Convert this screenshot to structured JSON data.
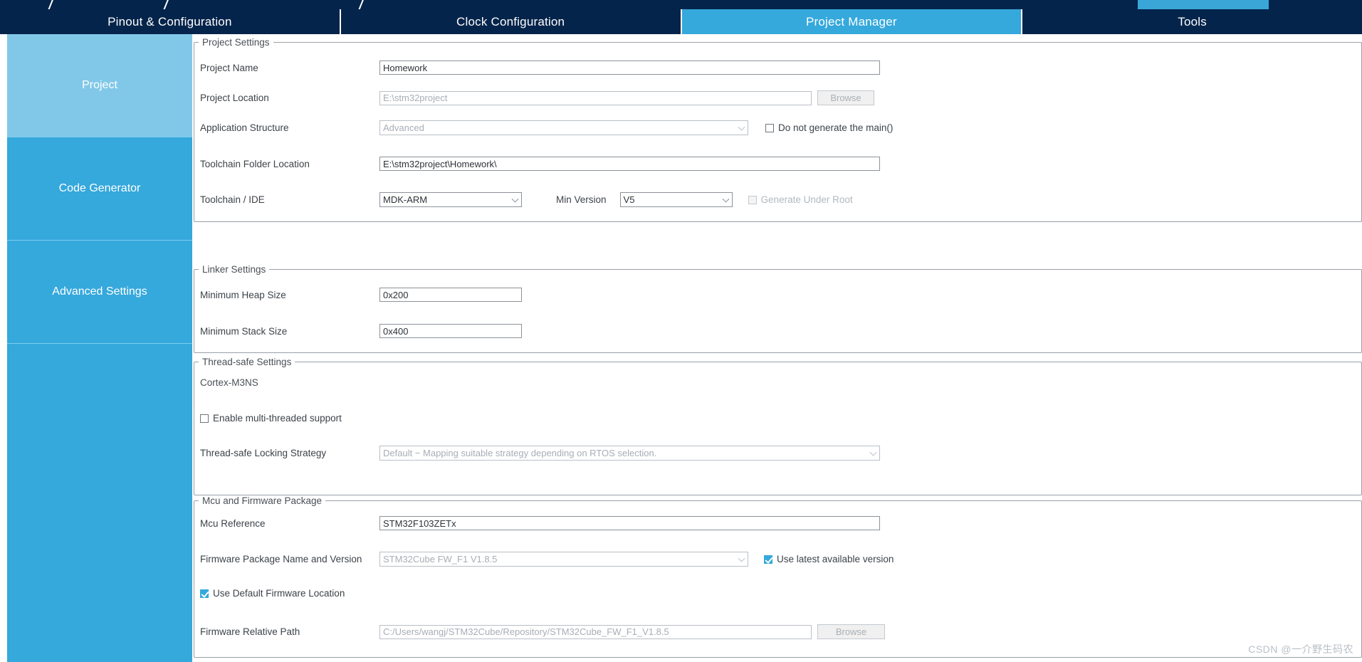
{
  "window": {
    "tabs": [
      {
        "label": "Pinout & Configuration",
        "active": false
      },
      {
        "label": "Clock Configuration",
        "active": false
      },
      {
        "label": "Project Manager",
        "active": true
      },
      {
        "label": "Tools",
        "active": false
      }
    ]
  },
  "sidebar": {
    "items": [
      {
        "label": "Project",
        "active": true
      },
      {
        "label": "Code Generator",
        "active": false
      },
      {
        "label": "Advanced Settings",
        "active": false
      }
    ]
  },
  "project_settings": {
    "legend": "Project Settings",
    "project_name": {
      "label": "Project Name",
      "value": "Homework"
    },
    "project_location": {
      "label": "Project Location",
      "value": "E:\\stm32project",
      "browse_label": "Browse"
    },
    "application_structure": {
      "label": "Application Structure",
      "value": "Advanced",
      "checkbox_label": "Do not generate the main()",
      "checkbox_checked": false
    },
    "toolchain_folder_location": {
      "label": "Toolchain Folder Location",
      "value": "E:\\stm32project\\Homework\\"
    },
    "toolchain_ide": {
      "label": "Toolchain / IDE",
      "value": "MDK-ARM",
      "min_version_label": "Min Version",
      "min_version_value": "V5",
      "generate_under_root_label": "Generate Under Root",
      "generate_under_root_checked": false
    }
  },
  "linker_settings": {
    "legend": "Linker Settings",
    "minimum_heap_size": {
      "label": "Minimum Heap Size",
      "value": "0x200"
    },
    "minimum_stack_size": {
      "label": "Minimum Stack Size",
      "value": "0x400"
    }
  },
  "thread_safe_settings": {
    "legend": "Thread-safe Settings",
    "core_name": "Cortex-M3NS",
    "enable_multithreaded": {
      "label": "Enable multi-threaded support",
      "checked": false
    },
    "locking_strategy": {
      "label": "Thread-safe Locking Strategy",
      "value": "Default  −  Mapping suitable strategy depending on RTOS selection."
    }
  },
  "mcu_firmware_package": {
    "legend": "Mcu and Firmware Package",
    "mcu_reference": {
      "label": "Mcu Reference",
      "value": "STM32F103ZETx"
    },
    "firmware_package": {
      "label": "Firmware Package Name and Version",
      "value": "STM32Cube FW_F1 V1.8.5",
      "checkbox_label": "Use latest available version",
      "checkbox_checked": true
    },
    "use_default_firmware_location": {
      "label": "Use Default Firmware Location",
      "checked": true
    },
    "firmware_relative_path": {
      "label": "Firmware Relative Path",
      "value": "C:/Users/wangj/STM32Cube/Repository/STM32Cube_FW_F1_V1.8.5",
      "browse_label": "Browse"
    }
  },
  "watermark": {
    "text": "CSDN @一介野生码农"
  },
  "colors": {
    "navy": "#05244b",
    "accent": "#35a8dc",
    "accent_light": "#81c8e8"
  }
}
